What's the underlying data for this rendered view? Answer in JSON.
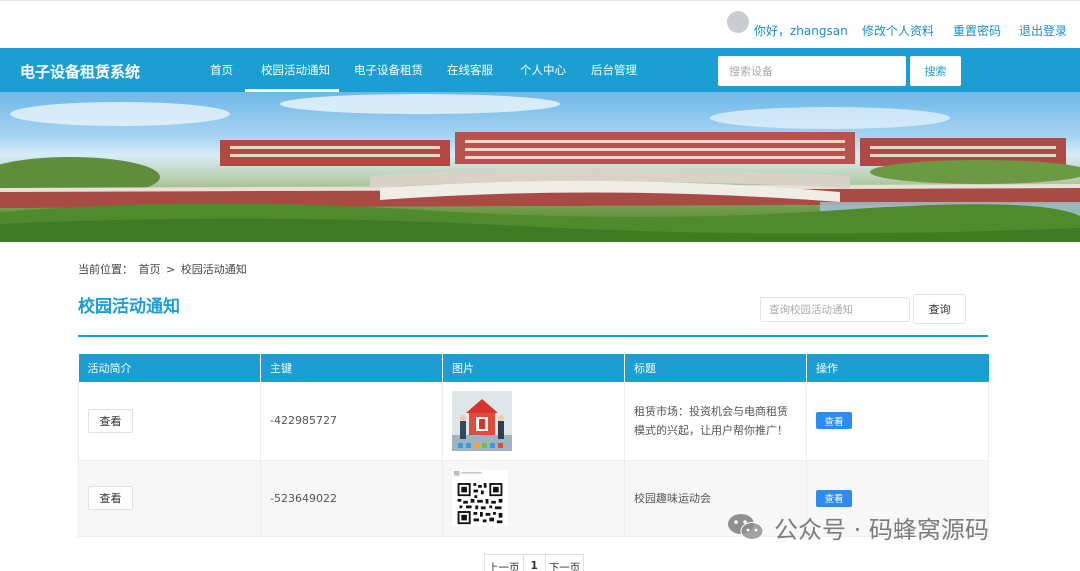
{
  "topbar": {
    "greeting": "你好，zhangsan",
    "edit_profile": "修改个人资料",
    "reset_password": "重置密码",
    "logout": "退出登录"
  },
  "nav": {
    "brand": "电子设备租赁系统",
    "items": [
      {
        "label": "首页"
      },
      {
        "label": "校园活动通知",
        "active": true
      },
      {
        "label": "电子设备租赁"
      },
      {
        "label": "在线客服"
      },
      {
        "label": "个人中心"
      },
      {
        "label": "后台管理"
      }
    ],
    "search_placeholder": "搜索设备",
    "search_button": "搜索"
  },
  "breadcrumb": {
    "prefix": "当前位置：",
    "home": "首页",
    "separator": ">",
    "current": "校园活动通知"
  },
  "page": {
    "title": "校园活动通知",
    "search_placeholder": "查询校园活动通知",
    "search_button": "查询"
  },
  "table": {
    "headers": [
      "活动简介",
      "主键",
      "图片",
      "标题",
      "操作"
    ],
    "rows": [
      {
        "intro_button": "查看",
        "id": "-422985727",
        "image": "rent-poster-thumbnail",
        "title": "租赁市场：投资机会与电商租赁模式的兴起，让用户帮你推广！",
        "action": "查看"
      },
      {
        "intro_button": "查看",
        "id": "-523649022",
        "image": "qr-code-thumbnail",
        "title": "校园趣味运动会",
        "action": "查看"
      }
    ]
  },
  "pagination": {
    "prev": "上一页",
    "current": "1",
    "next": "下一页"
  },
  "watermark": {
    "text": "公众号 · 码蜂窝源码"
  },
  "colors": {
    "brand_blue": "#1b9ed2",
    "link_blue": "#1a8fc9",
    "action_blue": "#2d8cf0"
  }
}
